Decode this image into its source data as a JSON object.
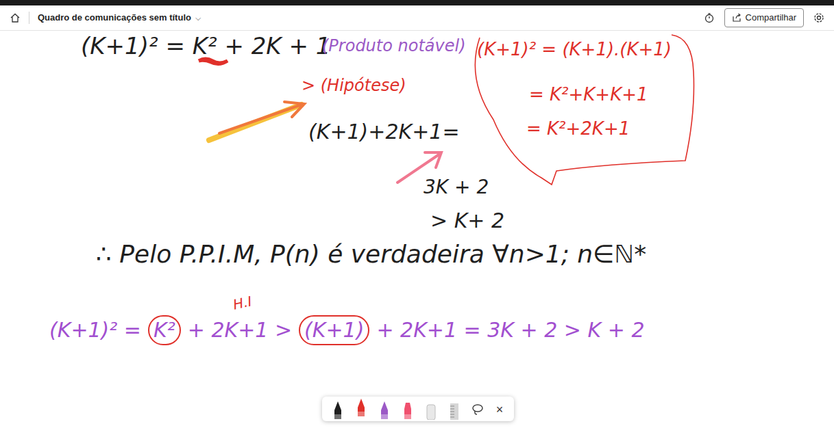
{
  "header": {
    "board_title": "Quadro de comunicações sem título",
    "title_chevron": "⌵",
    "share_button": "Compartilhar"
  },
  "canvas": {
    "notes": [
      {
        "text": "(K+1)² = K² + 2K + 1",
        "color": "#1f1f1f"
      },
      {
        "text": "(Produto notável)",
        "color": "#9b59c6"
      },
      {
        "text": "(K+1)² = (K+1).(K+1)",
        "color": "#e0302a"
      },
      {
        "text": "= K²+K+K+1",
        "color": "#e0302a"
      },
      {
        "text": "= K²+2K+1",
        "color": "#e0302a"
      },
      {
        "text": "> (Hipótese)",
        "color": "#e0302a"
      },
      {
        "text": "(K+1)+2K+1=",
        "color": "#1f1f1f"
      },
      {
        "text": "3K + 2",
        "color": "#1f1f1f"
      },
      {
        "text": "> K+ 2",
        "color": "#1f1f1f"
      },
      {
        "text": "∴ Pelo P.P.I.M, P(n) é verdadeira ∀n>1; n∈ℕ*",
        "color": "#1f1f1f"
      },
      {
        "text": "H.I",
        "color": "#e0302a"
      }
    ],
    "final_line": {
      "color": "#a24fd0",
      "segments": [
        {
          "text": "(K+1)² =",
          "circled": false
        },
        {
          "text": "K²",
          "circled": true
        },
        {
          "text": "+ 2K+1 >",
          "circled": false
        },
        {
          "text": "(K+1)",
          "circled": true
        },
        {
          "text": "+ 2K+1 = 3K + 2 > K + 2",
          "circled": false
        }
      ]
    }
  },
  "tools": [
    {
      "kind": "pen",
      "color": "#1f1f1f",
      "selected": false
    },
    {
      "kind": "pen",
      "color": "#e0302a",
      "selected": true
    },
    {
      "kind": "pen",
      "color": "#9b59c6",
      "selected": false
    },
    {
      "kind": "highlighter",
      "color": "#f0506e",
      "selected": false
    },
    {
      "kind": "eraser",
      "color": "#e8e8e8",
      "selected": false
    },
    {
      "kind": "ruler",
      "color": "#d6d6d6",
      "selected": false
    },
    {
      "kind": "lasso",
      "color": "#444444",
      "selected": false
    }
  ],
  "close_tool": "×"
}
